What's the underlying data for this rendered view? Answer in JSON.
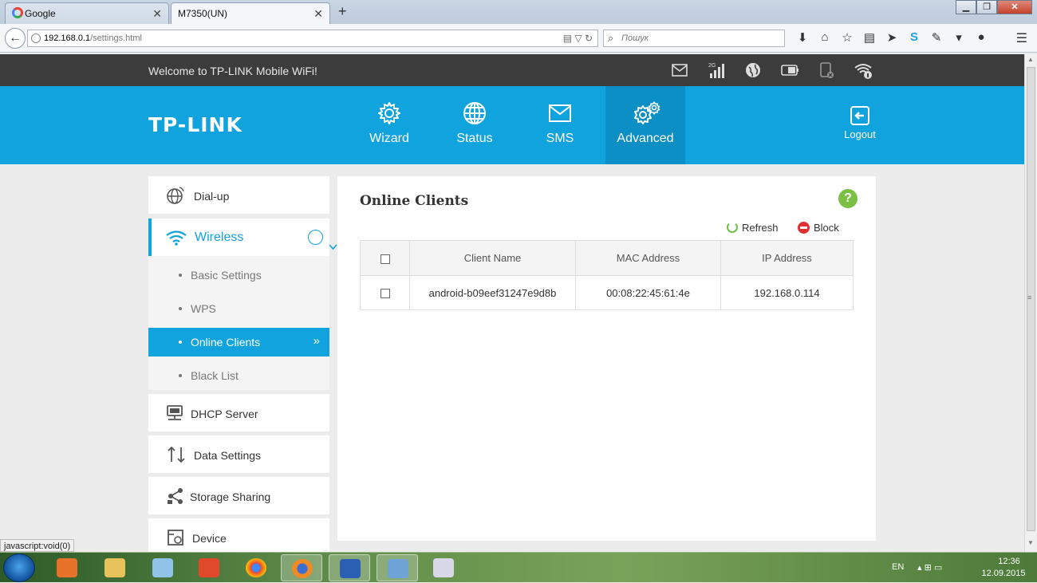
{
  "browser": {
    "tabs": [
      {
        "label": "Google"
      },
      {
        "label": "M7350(UN)"
      }
    ],
    "url_host": "192.168.0.1",
    "url_path": "/settings.html",
    "search_placeholder": "Пошук"
  },
  "router": {
    "welcome": "Welcome to TP-LINK Mobile WiFi!",
    "signal_label": "2G",
    "logo": "TP-LINK",
    "nav": {
      "wizard": "Wizard",
      "status": "Status",
      "sms": "SMS",
      "advanced": "Advanced",
      "logout": "Logout"
    },
    "active_nav": "Advanced"
  },
  "sidebar": {
    "dialup": "Dial-up",
    "wireless": "Wireless",
    "wireless_sub": {
      "basic": "Basic Settings",
      "wps": "WPS",
      "online": "Online Clients",
      "black": "Black List"
    },
    "dhcp": "DHCP Server",
    "data": "Data Settings",
    "storage": "Storage Sharing",
    "device": "Device"
  },
  "content": {
    "title": "Online Clients",
    "help": "?",
    "refresh": "Refresh",
    "block": "Block",
    "table": {
      "headers": [
        "Client Name",
        "MAC Address",
        "IP Address"
      ],
      "rows": [
        [
          "android-b09eef31247e9d8b",
          "00:08:22:45:61:4e",
          "192.168.0.114"
        ]
      ]
    }
  },
  "statusbar": {
    "link": "javascript:void(0)"
  },
  "taskbar": {
    "lang": "EN",
    "time": "12:36",
    "date": "12.09.2015"
  },
  "colors": {
    "accent": "#11a3dd",
    "header_dark": "#3c3c3c",
    "help_green": "#7ac143",
    "block_red": "#e03030"
  }
}
